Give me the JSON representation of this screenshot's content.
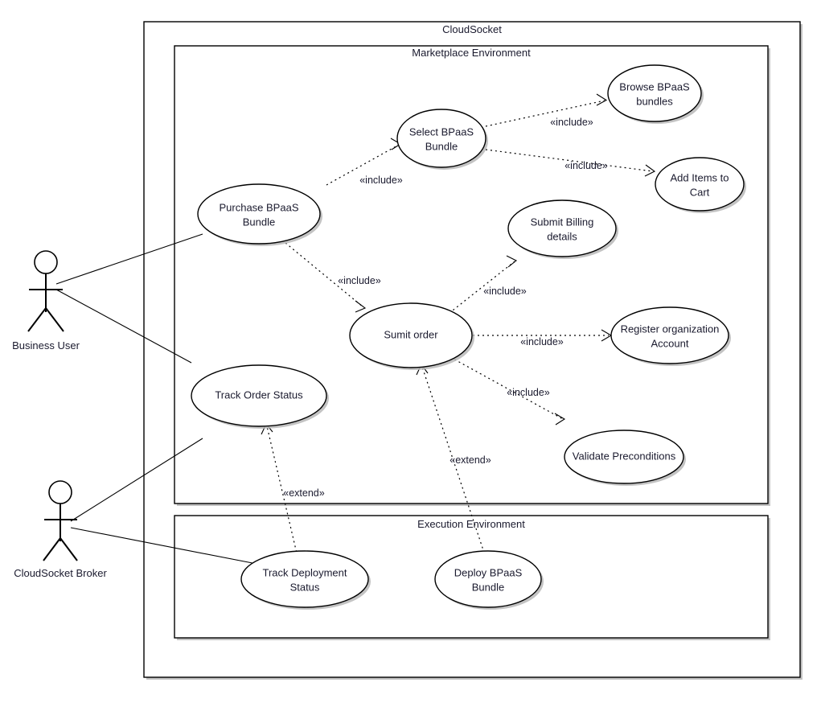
{
  "diagram": {
    "type": "uml-use-case-diagram",
    "outer_frame": {
      "title": "CloudSocket"
    },
    "subsystems": [
      {
        "id": "marketplace",
        "title": "Marketplace Environment"
      },
      {
        "id": "execution",
        "title": "Execution Environment"
      }
    ],
    "actors": [
      {
        "id": "business-user",
        "label": "Business User"
      },
      {
        "id": "cloudsocket-broker",
        "label": "CloudSocket Broker"
      }
    ],
    "use_cases": [
      {
        "id": "browse-bpaas-bundles",
        "label_line1": "Browse BPaaS",
        "label_line2": "bundles",
        "container": "marketplace"
      },
      {
        "id": "select-bpaas-bundle",
        "label_line1": "Select BPaaS",
        "label_line2": "Bundle",
        "container": "marketplace"
      },
      {
        "id": "add-items-to-cart",
        "label_line1": "Add Items to",
        "label_line2": "Cart",
        "container": "marketplace"
      },
      {
        "id": "purchase-bpaas-bundle",
        "label_line1": "Purchase BPaaS",
        "label_line2": "Bundle",
        "container": "marketplace"
      },
      {
        "id": "submit-billing-details",
        "label_line1": "Submit Billing",
        "label_line2": "details",
        "container": "marketplace"
      },
      {
        "id": "sumit-order",
        "label_line1": "Sumit order",
        "label_line2": "",
        "container": "marketplace"
      },
      {
        "id": "register-organization-account",
        "label_line1": "Register organization",
        "label_line2": "Account",
        "container": "marketplace"
      },
      {
        "id": "validate-preconditions",
        "label_line1": "Validate Preconditions",
        "label_line2": "",
        "container": "marketplace"
      },
      {
        "id": "track-order-status",
        "label_line1": "Track Order Status",
        "label_line2": "",
        "container": "marketplace"
      },
      {
        "id": "track-deployment-status",
        "label_line1": "Track Deployment",
        "label_line2": "Status",
        "container": "execution"
      },
      {
        "id": "deploy-bpaas-bundle",
        "label_line1": "Deploy BPaaS",
        "label_line2": "Bundle",
        "container": "execution"
      }
    ],
    "relationships": [
      {
        "id": "rel-select-browse",
        "from": "select-bpaas-bundle",
        "to": "browse-bpaas-bundles",
        "stereotype": "«include»"
      },
      {
        "id": "rel-select-cart",
        "from": "select-bpaas-bundle",
        "to": "add-items-to-cart",
        "stereotype": "«include»"
      },
      {
        "id": "rel-purchase-select",
        "from": "purchase-bpaas-bundle",
        "to": "select-bpaas-bundle",
        "stereotype": "«include»"
      },
      {
        "id": "rel-purchase-sumit",
        "from": "purchase-bpaas-bundle",
        "to": "sumit-order",
        "stereotype": "«include»"
      },
      {
        "id": "rel-sumit-billing",
        "from": "sumit-order",
        "to": "submit-billing-details",
        "stereotype": "«include»"
      },
      {
        "id": "rel-sumit-register",
        "from": "sumit-order",
        "to": "register-organization-account",
        "stereotype": "«include»"
      },
      {
        "id": "rel-sumit-validate",
        "from": "sumit-order",
        "to": "validate-preconditions",
        "stereotype": "«include»"
      },
      {
        "id": "rel-deploy-sumit",
        "from": "deploy-bpaas-bundle",
        "to": "sumit-order",
        "stereotype": "«extend»"
      },
      {
        "id": "rel-trackdep-trackorder",
        "from": "track-deployment-status",
        "to": "track-order-status",
        "stereotype": "«extend»"
      }
    ],
    "associations": [
      {
        "id": "assoc-user-purchase",
        "actor": "business-user",
        "use_case": "purchase-bpaas-bundle"
      },
      {
        "id": "assoc-user-track-order",
        "actor": "business-user",
        "use_case": "track-order-status"
      },
      {
        "id": "assoc-broker-track-order",
        "actor": "cloudsocket-broker",
        "use_case": "track-order-status"
      },
      {
        "id": "assoc-broker-track-deployment",
        "actor": "cloudsocket-broker",
        "use_case": "track-deployment-status"
      }
    ],
    "colors": {
      "stroke": "#000000",
      "fill": "#ffffff",
      "text": "#1a1a2e",
      "shadow": "#b9b9b9"
    }
  }
}
